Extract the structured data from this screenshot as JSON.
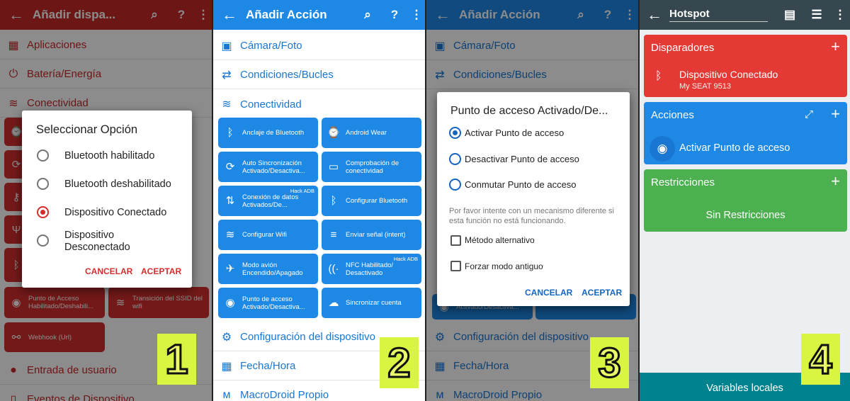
{
  "panel1": {
    "title": "Añadir dispa...",
    "categories": [
      "Aplicaciones",
      "Batería/Energía",
      "Conectividad",
      "Entrada de usuario",
      "Eventos de Dispositivo"
    ],
    "tiles": [
      {
        "label": "Punto de Acceso Habilitado/Deshabili..."
      },
      {
        "label": "Transición del SSID del wifi"
      },
      {
        "label": "Webhook (Url)"
      }
    ],
    "dialog": {
      "title": "Seleccionar Opción",
      "options": [
        "Bluetooth habilitado",
        "Bluetooth deshabilitado",
        "Dispositivo Conectado",
        "Dispositivo Desconectado"
      ],
      "selected": 2,
      "cancel": "CANCELAR",
      "accept": "ACEPTAR"
    },
    "badge": "1"
  },
  "panel2": {
    "title": "Añadir Acción",
    "categories_top": [
      "Cámara/Foto",
      "Condiciones/Bucles",
      "Conectividad"
    ],
    "tiles": [
      {
        "label": "Anclaje de Bluetooth",
        "icon": "bluetooth-icon"
      },
      {
        "label": "Android Wear",
        "icon": "watch-icon"
      },
      {
        "label": "Auto Sincronización Activado/Desactiva...",
        "icon": "sync-icon"
      },
      {
        "label": "Comprobación de conectividad",
        "icon": "monitor-icon"
      },
      {
        "label": "Conexión de datos Activados/De...",
        "icon": "data-icon",
        "hack": "Hack ADB"
      },
      {
        "label": "Configurar Bluetooth",
        "icon": "bluetooth-icon"
      },
      {
        "label": "Configurar Wifi",
        "icon": "wifi-icon"
      },
      {
        "label": "Enviar señal (intent)",
        "icon": "intent-icon"
      },
      {
        "label": "Modo avión Encendido/Apagado",
        "icon": "airplane-icon"
      },
      {
        "label": "NFC Habilitado/ Desactivado",
        "icon": "nfc-icon",
        "hack": "Hack ADB"
      },
      {
        "label": "Punto de acceso Activado/Desactiva...",
        "icon": "hotspot-icon"
      },
      {
        "label": "Sincronizar cuenta",
        "icon": "cloud-sync-icon"
      }
    ],
    "categories_bottom": [
      "Configuración del dispositivo",
      "Fecha/Hora",
      "MacroDroid Propio"
    ],
    "badge": "2"
  },
  "panel3": {
    "title": "Añadir Acción",
    "categories_top": [
      "Cámara/Foto",
      "Condiciones/Bucles"
    ],
    "categories_bottom": [
      "Configuración del dispositivo",
      "Fecha/Hora",
      "MacroDroid Propio"
    ],
    "behind_tile": "Activado/Desactiva...",
    "dialog": {
      "title": "Punto de acceso Activado/De...",
      "options": [
        "Activar Punto de acceso",
        "Desactivar Punto de acceso",
        "Conmutar Punto de acceso"
      ],
      "selected": 0,
      "note": "Por favor intente con un mecanismo diferente si esta función no está funcionando.",
      "checks": [
        "Método alternativo",
        "Forzar modo antiguo"
      ],
      "cancel": "CANCELAR",
      "accept": "ACEPTAR"
    },
    "badge": "3"
  },
  "panel4": {
    "title": "Hotspot",
    "triggers": {
      "header": "Disparadores",
      "item": "Dispositivo Conectado",
      "sub": "My SEAT 9513"
    },
    "actions": {
      "header": "Acciones",
      "item": "Activar Punto de acceso"
    },
    "restrictions": {
      "header": "Restricciones",
      "item": "Sin Restricciones"
    },
    "footer": "Variables locales",
    "badge": "4"
  },
  "colors": {
    "red": "#d32f2f",
    "blue": "#1e88e5",
    "green": "#4caf50",
    "teal": "#00838f",
    "badge": "#d9f542"
  }
}
